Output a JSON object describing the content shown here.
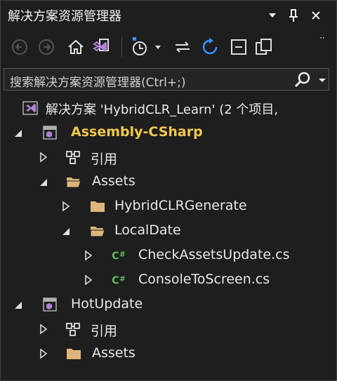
{
  "window": {
    "title": "解决方案资源管理器",
    "controls": [
      "▾",
      "⊥",
      "✕"
    ]
  },
  "toolbar": {
    "overflow": "ᐧᐧ"
  },
  "search": {
    "placeholder": "搜索解决方案资源管理器(Ctrl+;)"
  },
  "tree": {
    "solution": "解决方案 'HybridCLR_Learn' (2 个项目,",
    "project1": "Assembly-CSharp",
    "p1_refs": "引用",
    "p1_assets": "Assets",
    "hybrid_gen": "HybridCLRGenerate",
    "local_date": "LocalDate",
    "file1": "CheckAssetsUpdate.cs",
    "file2": "ConsoleToScreen.cs",
    "project2": "HotUpdate",
    "p2_refs": "引用",
    "p2_assets": "Assets"
  },
  "colors": {
    "background": "#1e1e1e",
    "accent_blue": "#3794ff",
    "vs_purple": "#b180d7",
    "folder": "#dcb67a",
    "csharp_green": "#5db85b",
    "bold_project": "#f2c94c"
  }
}
